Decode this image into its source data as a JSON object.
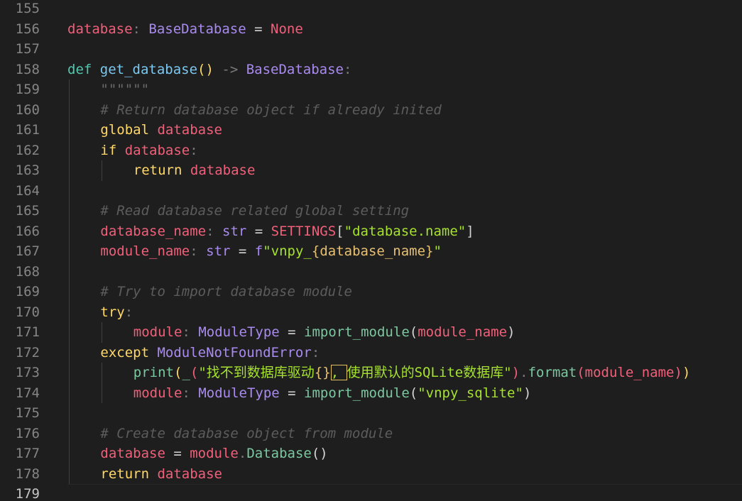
{
  "editor": {
    "language": "python",
    "active_line": "179",
    "lines": [
      {
        "num": "155",
        "indent": 0,
        "tokens": []
      },
      {
        "num": "156",
        "indent": 0,
        "tokens": [
          {
            "t": "database",
            "c": "#f0607a"
          },
          {
            "t": ": ",
            "c": "#7a7a7a"
          },
          {
            "t": "BaseDatabase",
            "c": "#a98bf0"
          },
          {
            "t": " = ",
            "c": "#d4d4d4"
          },
          {
            "t": "None",
            "c": "#f0607a"
          }
        ]
      },
      {
        "num": "157",
        "indent": 0,
        "tokens": []
      },
      {
        "num": "158",
        "indent": 0,
        "tokens": [
          {
            "t": "def ",
            "c": "#4ec9b0"
          },
          {
            "t": "get_database",
            "c": "#7bc8f0"
          },
          {
            "t": "()",
            "c": "#ffd866"
          },
          {
            "t": " -> ",
            "c": "#7a7a7a"
          },
          {
            "t": "BaseDatabase",
            "c": "#a98bf0"
          },
          {
            "t": ":",
            "c": "#7a7a7a"
          }
        ]
      },
      {
        "num": "159",
        "indent": 1,
        "tokens": [
          {
            "t": "\"\"\"\"\"\"",
            "c": "#6a6a6a",
            "i": true
          }
        ]
      },
      {
        "num": "160",
        "indent": 1,
        "tokens": [
          {
            "t": "# Return database object if already inited",
            "c": "#5c5c5c",
            "i": true
          }
        ]
      },
      {
        "num": "161",
        "indent": 1,
        "tokens": [
          {
            "t": "global ",
            "c": "#ffd866"
          },
          {
            "t": "database",
            "c": "#f0607a"
          }
        ]
      },
      {
        "num": "162",
        "indent": 1,
        "tokens": [
          {
            "t": "if ",
            "c": "#ffd866"
          },
          {
            "t": "database",
            "c": "#f0607a"
          },
          {
            "t": ":",
            "c": "#7a7a7a"
          }
        ]
      },
      {
        "num": "163",
        "indent": 2,
        "tokens": [
          {
            "t": "return ",
            "c": "#ffd866"
          },
          {
            "t": "database",
            "c": "#f0607a"
          }
        ]
      },
      {
        "num": "164",
        "indent": 1,
        "tokens": []
      },
      {
        "num": "165",
        "indent": 1,
        "tokens": [
          {
            "t": "# Read database related global setting",
            "c": "#5c5c5c",
            "i": true
          }
        ]
      },
      {
        "num": "166",
        "indent": 1,
        "tokens": [
          {
            "t": "database_name",
            "c": "#f0607a"
          },
          {
            "t": ": ",
            "c": "#7a7a7a"
          },
          {
            "t": "str",
            "c": "#a98bf0"
          },
          {
            "t": " = ",
            "c": "#d4d4d4"
          },
          {
            "t": "SETTINGS",
            "c": "#f0607a"
          },
          {
            "t": "[",
            "c": "#d4d4d4"
          },
          {
            "t": "\"database.name\"",
            "c": "#a6e22e"
          },
          {
            "t": "]",
            "c": "#d4d4d4"
          }
        ]
      },
      {
        "num": "167",
        "indent": 1,
        "tokens": [
          {
            "t": "module_name",
            "c": "#f0607a"
          },
          {
            "t": ": ",
            "c": "#7a7a7a"
          },
          {
            "t": "str",
            "c": "#a98bf0"
          },
          {
            "t": " = ",
            "c": "#d4d4d4"
          },
          {
            "t": "f",
            "c": "#a98bf0"
          },
          {
            "t": "\"vnpy_",
            "c": "#a6e22e"
          },
          {
            "t": "{database_name}",
            "c": "#e8c070"
          },
          {
            "t": "\"",
            "c": "#a6e22e"
          }
        ]
      },
      {
        "num": "168",
        "indent": 1,
        "tokens": []
      },
      {
        "num": "169",
        "indent": 1,
        "tokens": [
          {
            "t": "# Try to import database module",
            "c": "#5c5c5c",
            "i": true
          }
        ]
      },
      {
        "num": "170",
        "indent": 1,
        "tokens": [
          {
            "t": "try",
            "c": "#ffd866"
          },
          {
            "t": ":",
            "c": "#7a7a7a"
          }
        ]
      },
      {
        "num": "171",
        "indent": 2,
        "tokens": [
          {
            "t": "module",
            "c": "#f0607a"
          },
          {
            "t": ": ",
            "c": "#7a7a7a"
          },
          {
            "t": "ModuleType",
            "c": "#a98bf0"
          },
          {
            "t": " = ",
            "c": "#d4d4d4"
          },
          {
            "t": "import_module",
            "c": "#7bc8a0"
          },
          {
            "t": "(",
            "c": "#d4d4d4"
          },
          {
            "t": "module_name",
            "c": "#f0607a"
          },
          {
            "t": ")",
            "c": "#d4d4d4"
          }
        ]
      },
      {
        "num": "172",
        "indent": 1,
        "tokens": [
          {
            "t": "except ",
            "c": "#ffd866"
          },
          {
            "t": "ModuleNotFoundError",
            "c": "#a98bf0"
          },
          {
            "t": ":",
            "c": "#7a7a7a"
          }
        ]
      },
      {
        "num": "173",
        "indent": 2,
        "tokens": [
          {
            "t": "print",
            "c": "#7bc8a0"
          },
          {
            "t": "(",
            "c": "#ffd866"
          },
          {
            "t": "_",
            "c": "#7bc8a0"
          },
          {
            "t": "(",
            "c": "#f0607a"
          },
          {
            "t": "\"找不到数据库驱动",
            "c": "#a6e22e"
          },
          {
            "t": "{}",
            "c": "#e8c070"
          },
          {
            "t": ", ",
            "c": "#a6e22e",
            "box": true
          },
          {
            "t": "使用默认的SQLite数据库\"",
            "c": "#a6e22e"
          },
          {
            "t": ")",
            "c": "#f0607a"
          },
          {
            "t": ".",
            "c": "#7a7a7a"
          },
          {
            "t": "format",
            "c": "#7bc8a0"
          },
          {
            "t": "(",
            "c": "#f0607a"
          },
          {
            "t": "module_name",
            "c": "#f0607a"
          },
          {
            "t": ")",
            "c": "#f0607a"
          },
          {
            "t": ")",
            "c": "#ffd866"
          }
        ]
      },
      {
        "num": "174",
        "indent": 2,
        "tokens": [
          {
            "t": "module",
            "c": "#f0607a"
          },
          {
            "t": ": ",
            "c": "#7a7a7a"
          },
          {
            "t": "ModuleType",
            "c": "#a98bf0"
          },
          {
            "t": " = ",
            "c": "#d4d4d4"
          },
          {
            "t": "import_module",
            "c": "#7bc8a0"
          },
          {
            "t": "(",
            "c": "#d4d4d4"
          },
          {
            "t": "\"vnpy_sqlite\"",
            "c": "#a6e22e"
          },
          {
            "t": ")",
            "c": "#d4d4d4"
          }
        ]
      },
      {
        "num": "175",
        "indent": 1,
        "tokens": []
      },
      {
        "num": "176",
        "indent": 1,
        "tokens": [
          {
            "t": "# Create database object from module",
            "c": "#5c5c5c",
            "i": true
          }
        ]
      },
      {
        "num": "177",
        "indent": 1,
        "tokens": [
          {
            "t": "database",
            "c": "#f0607a"
          },
          {
            "t": " = ",
            "c": "#d4d4d4"
          },
          {
            "t": "module",
            "c": "#f0607a"
          },
          {
            "t": ".",
            "c": "#7a7a7a"
          },
          {
            "t": "Database",
            "c": "#7bc8a0"
          },
          {
            "t": "()",
            "c": "#d4d4d4"
          }
        ]
      },
      {
        "num": "178",
        "indent": 1,
        "tokens": [
          {
            "t": "return ",
            "c": "#ffd866"
          },
          {
            "t": "database",
            "c": "#f0607a"
          }
        ]
      },
      {
        "num": "179",
        "indent": 0,
        "tokens": []
      }
    ]
  }
}
